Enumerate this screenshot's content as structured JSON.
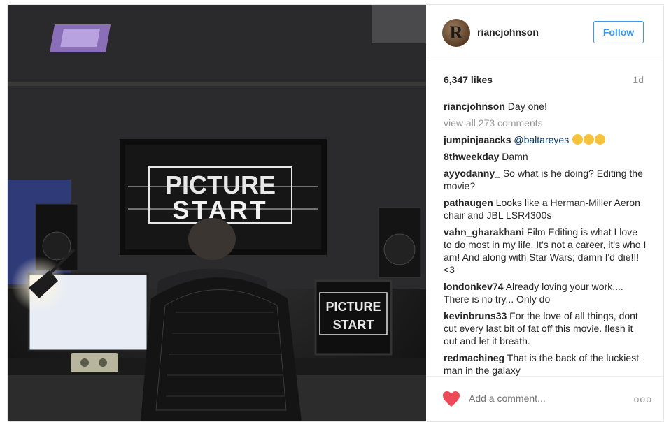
{
  "post": {
    "username": "riancjohnson",
    "follow_label": "Follow",
    "avatar_letter": "R",
    "likes": "6,347 likes",
    "time": "1d",
    "caption_user": "riancjohnson",
    "caption_text": "Day one!",
    "view_all": "view all 273 comments",
    "photo_text_top": "PICTURE",
    "photo_text_bottom": "START",
    "photo_small_top": "PICTURE",
    "photo_small_bottom": "START"
  },
  "comments": [
    {
      "user": "jumpinjaaacks",
      "text": "@baltareyes"
    },
    {
      "user": "8thweekday",
      "text": "Damn"
    },
    {
      "user": "ayyodanny_",
      "text": "So what is he doing? Editing the movie?"
    },
    {
      "user": "pathaugen",
      "text": "Looks like a Herman-Miller Aeron chair and JBL LSR4300s"
    },
    {
      "user": "vahn_gharakhani",
      "text": "Film Editing is what I love to do most in my life. It's not a career, it's who I am! And along with Star Wars; damn I'd die!!! <3"
    },
    {
      "user": "londonkev74",
      "text": "Already loving your work.... There is no try... Only do"
    },
    {
      "user": "kevinbruns33",
      "text": "For the love of all things, dont cut every last bit of fat off this movie. flesh it out and let it breath."
    },
    {
      "user": "redmachineg",
      "text": "That is the back of the luckiest man in the galaxy"
    }
  ],
  "footer": {
    "add_comment_placeholder": "Add a comment...",
    "more": "ooo"
  },
  "colors": {
    "accent": "#3897f0",
    "heart": "#ed4956",
    "muted": "#999999"
  }
}
